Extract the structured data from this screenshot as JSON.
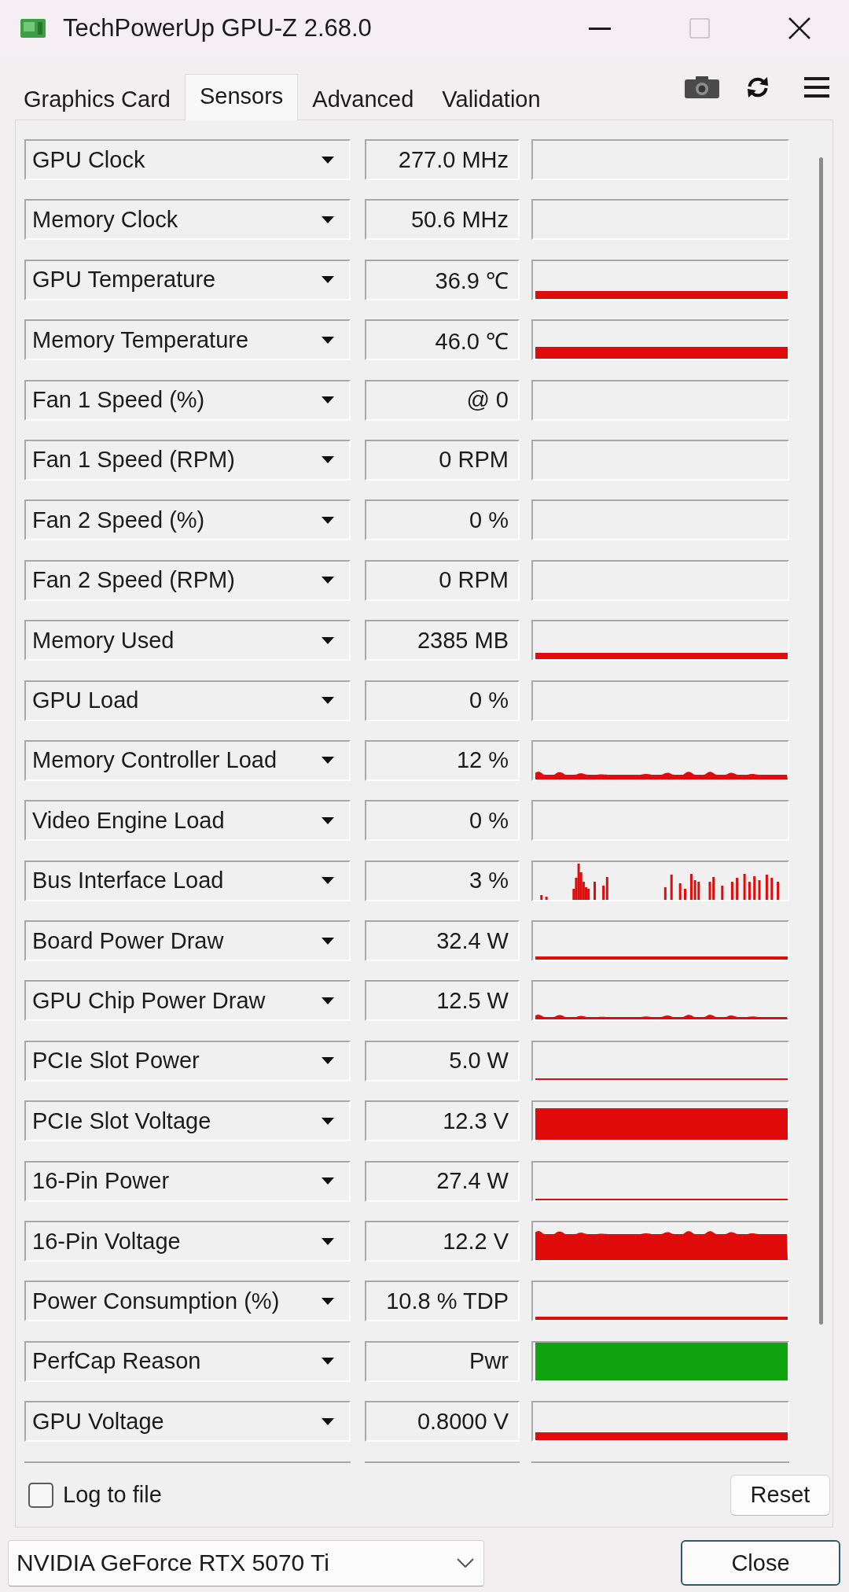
{
  "window": {
    "title": "TechPowerUp GPU-Z 2.68.0",
    "maximize_button": {
      "disabled": true
    }
  },
  "tabs": [
    {
      "label": "Graphics Card",
      "selected": false
    },
    {
      "label": "Sensors",
      "selected": true
    },
    {
      "label": "Advanced",
      "selected": false
    },
    {
      "label": "Validation",
      "selected": false
    }
  ],
  "sensors": [
    {
      "name": "GPU Clock",
      "value": "277.0 MHz"
    },
    {
      "name": "Memory Clock",
      "value": "50.6 MHz"
    },
    {
      "name": "GPU Temperature",
      "value": "36.9 ℃",
      "graph": {
        "kind": "bar",
        "color": "#e00b0b"
      }
    },
    {
      "name": "Memory Temperature",
      "value": "46.0 ℃",
      "graph": {
        "kind": "thickbar",
        "color": "#e00b0b"
      }
    },
    {
      "name": "Fan 1 Speed (%)",
      "value": "@ 0"
    },
    {
      "name": "Fan 1 Speed (RPM)",
      "value": "0 RPM"
    },
    {
      "name": "Fan 2 Speed (%)",
      "value": "0 %"
    },
    {
      "name": "Fan 2 Speed (RPM)",
      "value": "0 RPM"
    },
    {
      "name": "Memory Used",
      "value": "2385 MB",
      "graph": {
        "kind": "band",
        "color": "#e00b0b"
      }
    },
    {
      "name": "GPU Load",
      "value": "0 %"
    },
    {
      "name": "Memory Controller Load",
      "value": "12 %",
      "graph": {
        "kind": "bumpy",
        "color": "#e00b0b"
      }
    },
    {
      "name": "Video Engine Load",
      "value": "0 %"
    },
    {
      "name": "Bus Interface Load",
      "value": "3 %",
      "graph": {
        "kind": "spikes",
        "color": "#e00b0b"
      }
    },
    {
      "name": "Board Power Draw",
      "value": "32.4 W",
      "graph": {
        "kind": "line",
        "color": "#e00b0b"
      }
    },
    {
      "name": "GPU Chip Power Draw",
      "value": "12.5 W",
      "graph": {
        "kind": "dashed",
        "color": "#e00b0b"
      }
    },
    {
      "name": "PCIe Slot Power",
      "value": "5.0 W",
      "graph": {
        "kind": "hairline",
        "color": "#e00b0b"
      }
    },
    {
      "name": "PCIe Slot Voltage",
      "value": "12.3 V",
      "graph": {
        "kind": "block",
        "color": "#e00b0b"
      }
    },
    {
      "name": "16-Pin Power",
      "value": "27.4 W",
      "graph": {
        "kind": "hairline",
        "color": "#e00b0b"
      }
    },
    {
      "name": "16-Pin Voltage",
      "value": "12.2 V",
      "graph": {
        "kind": "ragged",
        "color": "#e00b0b"
      }
    },
    {
      "name": "Power Consumption (%)",
      "value": "10.8 % TDP",
      "graph": {
        "kind": "line",
        "color": "#e00b0b"
      }
    },
    {
      "name": "PerfCap Reason",
      "value": "Pwr",
      "graph": {
        "kind": "full",
        "color": "#0fa30f"
      }
    },
    {
      "name": "GPU Voltage",
      "value": "0.8000 V",
      "graph": {
        "kind": "bar",
        "color": "#e00b0b"
      }
    }
  ],
  "log_to_file": {
    "label": "Log to file",
    "checked": false
  },
  "reset_button": {
    "label": "Reset"
  },
  "gpu_select": {
    "value": "NVIDIA GeForce RTX 5070 Ti"
  },
  "close_button": {
    "label": "Close"
  }
}
